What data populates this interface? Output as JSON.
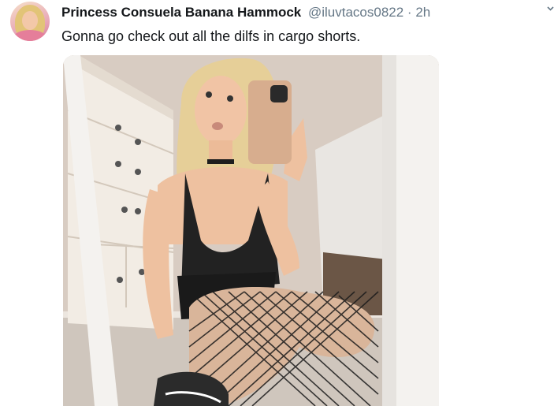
{
  "tweet": {
    "avatar_icon": "avatar-photo",
    "display_name": "Princess Consuela Banana Hammock",
    "handle": "@iluvtacos0822",
    "separator": "·",
    "timestamp": "2h",
    "menu_icon": "chevron-down-icon",
    "text": "Gonna go check out all the dilfs in cargo shorts.",
    "media": {
      "type": "photo",
      "description_icon": "mirror-selfie-photo"
    }
  },
  "colors": {
    "name": "#14171a",
    "secondary": "#657786",
    "background": "#ffffff"
  }
}
